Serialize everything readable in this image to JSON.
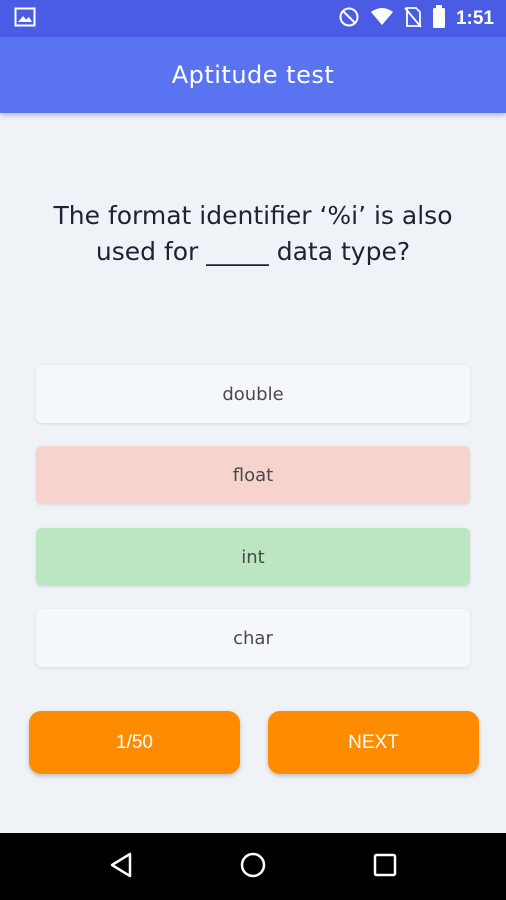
{
  "status_bar": {
    "time": "1:51",
    "icons": [
      "image-icon",
      "do-not-disturb-icon",
      "wifi-icon",
      "no-sim-icon",
      "battery-icon"
    ]
  },
  "app_bar": {
    "title": "Aptitude test"
  },
  "question": {
    "text": "The format identifier ‘%i’ is also used for _____ data type?"
  },
  "options": [
    {
      "label": "double",
      "state": "default",
      "color": "#f5f8fb"
    },
    {
      "label": "float",
      "state": "wrong",
      "color": "#f6d3cc"
    },
    {
      "label": "int",
      "state": "correct",
      "color": "#bce6c2"
    },
    {
      "label": "char",
      "state": "default",
      "color": "#f5f8fb"
    }
  ],
  "footer": {
    "counter_label": "1/50",
    "next_label": "NEXT",
    "accent_color": "#ff8c00"
  },
  "nav_bar": {
    "icons": [
      "back-icon",
      "home-icon",
      "recents-icon"
    ]
  },
  "colors": {
    "status_bar": "#4a5ce4",
    "app_bar": "#5a73f0",
    "background": "#eff3f8"
  }
}
